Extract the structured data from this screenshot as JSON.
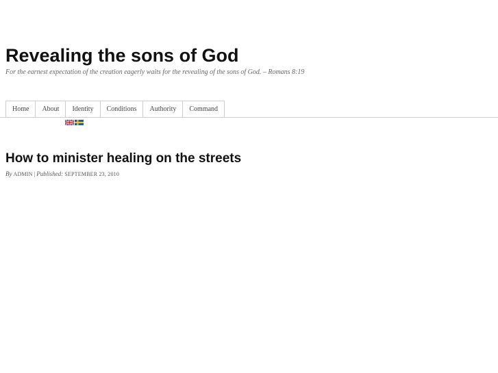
{
  "site": {
    "title": "Revealing the sons of God",
    "tagline": "For the earnest expectation of the creation eagerly waits for the revealing of the sons of God. – Romans 8:19"
  },
  "nav": {
    "items": [
      {
        "label": "Home"
      },
      {
        "label": "About"
      },
      {
        "label": "Identity"
      },
      {
        "label": "Conditions"
      },
      {
        "label": "Authority"
      },
      {
        "label": "Command"
      }
    ]
  },
  "languages": {
    "flags": [
      "uk-flag-icon",
      "sweden-flag-icon"
    ]
  },
  "post": {
    "title": "How to minister healing on the streets",
    "by_label": "By",
    "author": "ADMIN",
    "separator": "|",
    "published_label": "Published:",
    "date": "SEPTEMBER 23, 2010"
  }
}
